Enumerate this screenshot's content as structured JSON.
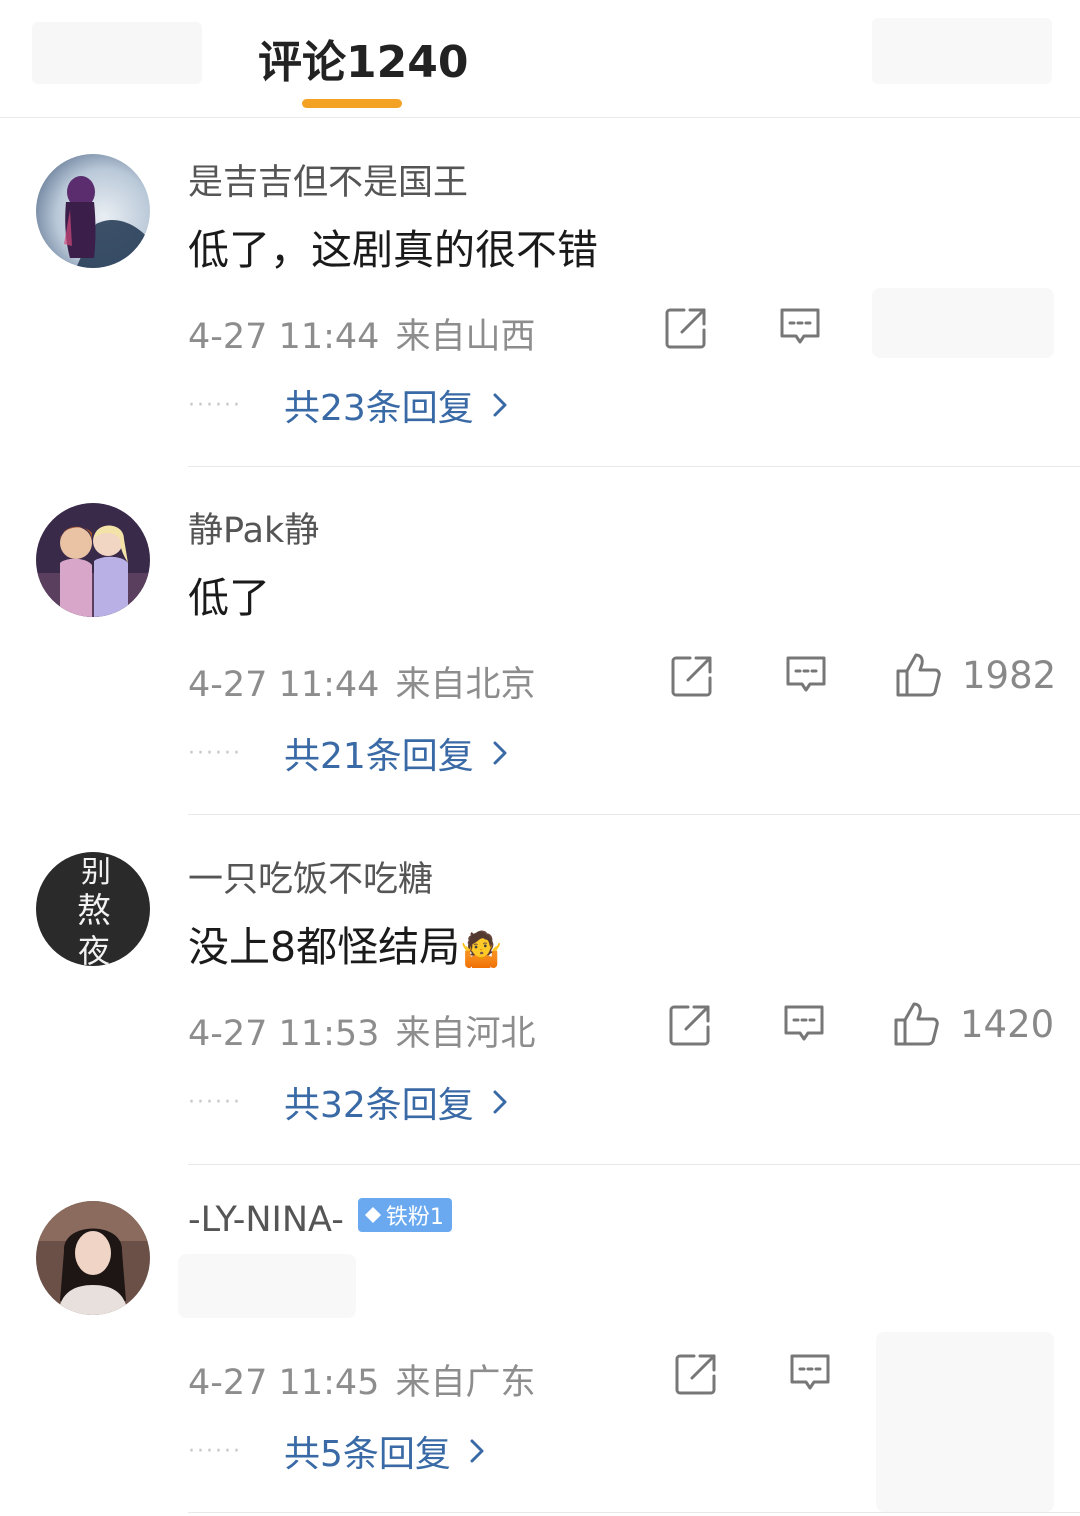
{
  "header": {
    "tab_title": "评论1240"
  },
  "comments": [
    {
      "username": "是吉吉但不是国王",
      "text": "低了，这剧真的很不错",
      "date": "4-27 11:44",
      "location": "来自山西",
      "likes": "",
      "replies": "共23条回复",
      "avatar": "hooded-figure-avatar"
    },
    {
      "username": "静Pak静",
      "text": "低了",
      "date": "4-27 11:44",
      "location": "来自北京",
      "likes": "1982",
      "replies": "共21条回复",
      "avatar": "cartoon-sisters-avatar"
    },
    {
      "username": "一只吃饭不吃糖",
      "text": "没上8都怪结局",
      "emoji": "🤷",
      "date": "4-27 11:53",
      "location": "来自河北",
      "likes": "1420",
      "replies": "共32条回复",
      "avatar": "calligraphy-avatar",
      "avatar_text": [
        "别",
        "熬",
        "夜"
      ]
    },
    {
      "username": "-LY-NINA-",
      "badge": "铁粉1",
      "text": "",
      "date": "4-27 11:45",
      "location": "来自广东",
      "likes": "",
      "replies": "共5条回复",
      "avatar": "girl-portrait-avatar"
    }
  ],
  "icons": {
    "share": "share-icon",
    "comment": "comment-icon",
    "like": "thumbs-up-icon",
    "chevron": "chevron-right-icon"
  },
  "colors": {
    "accent": "#f4a224",
    "link": "#3a6aa6",
    "badge": "#6aa9f0"
  }
}
